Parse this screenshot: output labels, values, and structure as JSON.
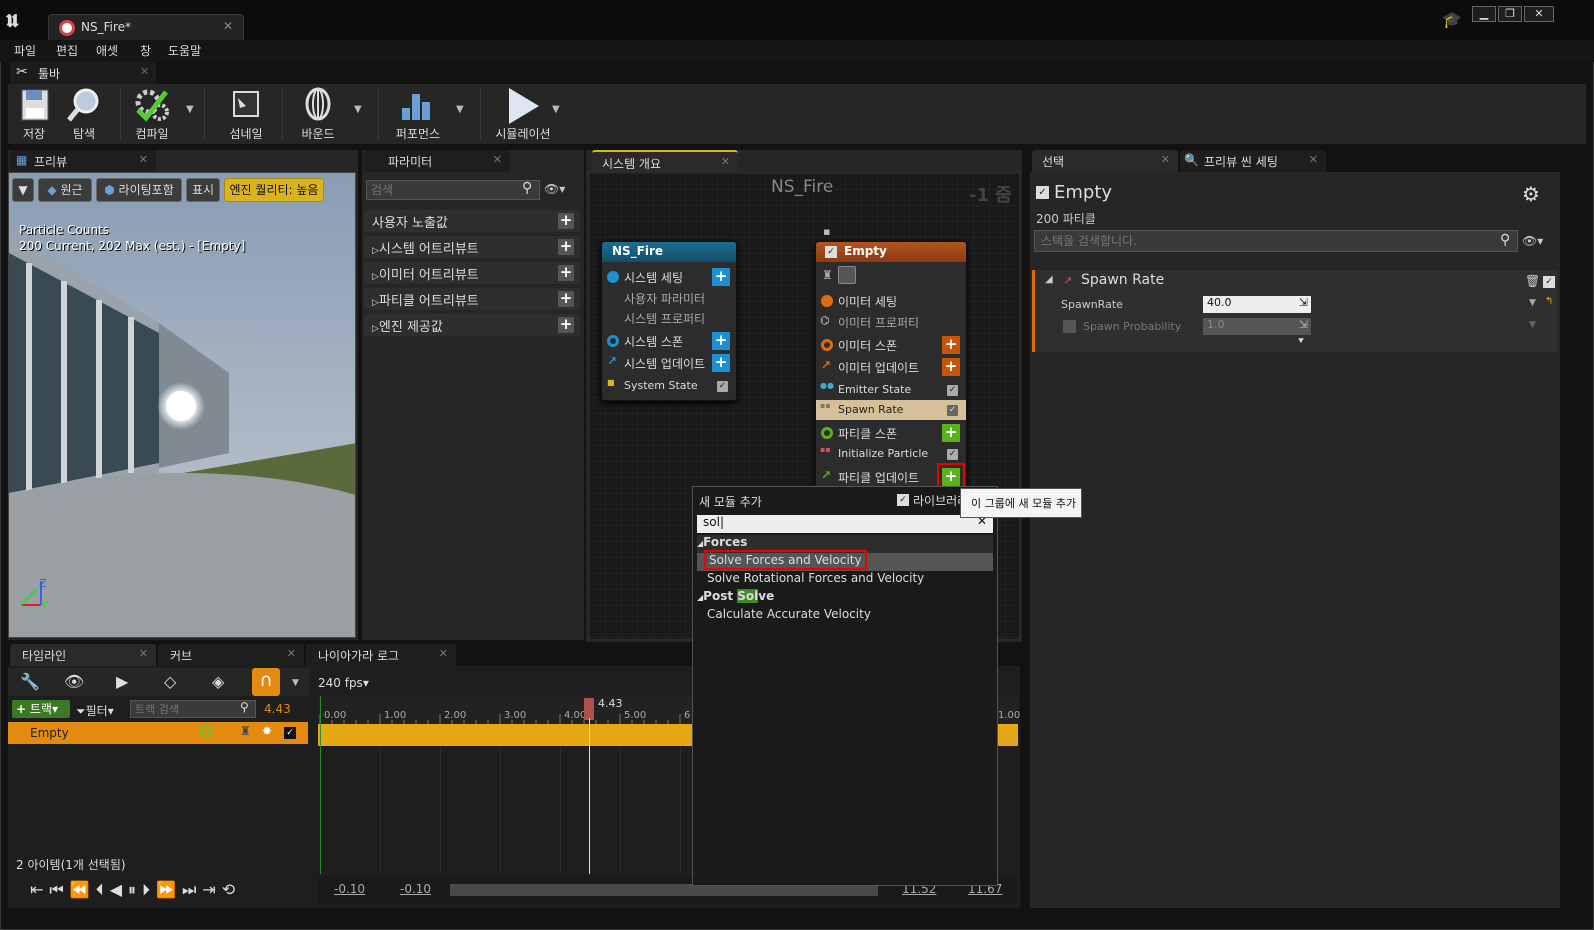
{
  "window": {
    "title_tab": "NS_Fire*",
    "buttons": [
      "▁",
      "❐",
      "✕"
    ]
  },
  "menu": [
    "파일",
    "편집",
    "애셋",
    "창",
    "도움말"
  ],
  "toolbar": {
    "tab_label": "툴바",
    "buttons": [
      {
        "label": "저장",
        "icon": "save-icon"
      },
      {
        "label": "탐색",
        "icon": "browse-icon"
      },
      {
        "label": "컴파일",
        "icon": "compile-icon"
      },
      {
        "label": "섬네일",
        "icon": "thumbnail-icon"
      },
      {
        "label": "바운드",
        "icon": "bounds-icon"
      },
      {
        "label": "퍼포먼스",
        "icon": "performance-icon"
      },
      {
        "label": "시뮬레이션",
        "icon": "simulation-icon"
      }
    ]
  },
  "preview": {
    "tab": "프리뷰",
    "buttons": [
      "원근",
      "라이팅포함",
      "표시",
      "엔진 퀄리티: 높음"
    ],
    "particle_counts_title": "Particle Counts",
    "particle_counts_value": "200 Current, 202 Max (est.) - [Empty]",
    "axis_z": "Z",
    "axis_y": "Y"
  },
  "params": {
    "tab": "파라미터",
    "search_placeholder": "검색",
    "rows": [
      "사용자 노출값",
      "시스템 어트리뷰트",
      "이미터 어트리뷰트",
      "파티클 어트리뷰트",
      "엔진 제공값"
    ]
  },
  "graph": {
    "tab": "시스템 개요",
    "title": "NS_Fire",
    "zoom": "-1 줌",
    "system_node": {
      "title": "NS_Fire",
      "rows": [
        {
          "label": "시스템 세팅",
          "type": "header",
          "color": "#1e8fd0"
        },
        {
          "label": "사용자 파라미터",
          "type": "sub"
        },
        {
          "label": "시스템 프로퍼티",
          "type": "sub"
        },
        {
          "label": "시스템 스폰",
          "type": "header",
          "color": "#1e8fd0"
        },
        {
          "label": "시스템 업데이트",
          "type": "header",
          "color": "#1e8fd0"
        },
        {
          "label": "System State",
          "type": "module"
        }
      ]
    },
    "emitter_node": {
      "title": "Empty",
      "rows": [
        {
          "label": "이미터 세팅",
          "type": "header",
          "color": "#e06a10"
        },
        {
          "label": "이미터 프로퍼티",
          "type": "sub"
        },
        {
          "label": "이미터 스폰",
          "type": "header",
          "color": "#e06a10"
        },
        {
          "label": "이미터 업데이트",
          "type": "header",
          "color": "#e06a10"
        },
        {
          "label": "Emitter State",
          "type": "module"
        },
        {
          "label": "Spawn Rate",
          "type": "module-selected"
        },
        {
          "label": "파티클 스폰",
          "type": "header",
          "color": "#59b21c"
        },
        {
          "label": "Initialize Particle",
          "type": "module"
        },
        {
          "label": "파티클 업데이트",
          "type": "header",
          "color": "#59b21c"
        }
      ]
    }
  },
  "details": {
    "tabs": [
      "선택",
      "프리뷰 씬 세팅"
    ],
    "emitter_name": "Empty",
    "particle_count": "200 파티클",
    "search_placeholder": "스택을 검색합니다.",
    "section": "Spawn Rate",
    "props": [
      {
        "name": "SpawnRate",
        "value": "40.0"
      },
      {
        "name": "Spawn Probability",
        "value": "1.0"
      }
    ]
  },
  "timeline": {
    "tabs": [
      "타임라인",
      "커브",
      "나이아가라 로그"
    ],
    "fps": "240 fps",
    "track_button": "트랙",
    "filter_button": "필터",
    "search_placeholder": "트랙 검색",
    "current_time": "4.43",
    "track_name": "Empty",
    "ticks": [
      "0.00",
      "1.00",
      "2.00",
      "3.00",
      "4.00",
      "5.00",
      "6"
    ],
    "end_tick": "1.00",
    "playhead_label": "4.43",
    "items_status": "2 아이템(1개 선택됨)",
    "range": [
      "-0.10",
      "-0.10",
      "11.52",
      "11.67"
    ]
  },
  "popup": {
    "title": "새 모듈 추가",
    "library_label": "라이브러리",
    "search_value": "sol",
    "tooltip": "이 그룹에 새 모듈 추가",
    "groups": [
      {
        "name": "Forces",
        "items": [
          "Solve Forces and Velocity",
          "Solve Rotational Forces and Velocity"
        ]
      },
      {
        "name_prefix": "Post ",
        "name_highlight": "Sol",
        "name_suffix": "ve",
        "items": [
          "Calculate Accurate Velocity"
        ]
      }
    ]
  }
}
